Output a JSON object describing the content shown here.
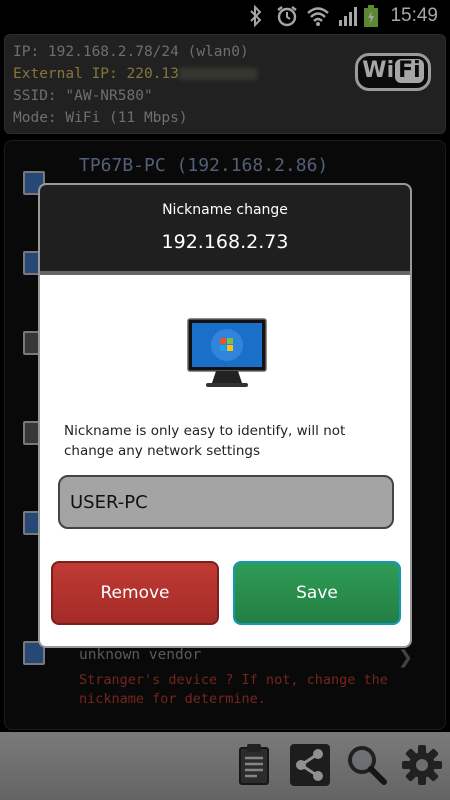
{
  "status_bar": {
    "time": "15:49",
    "icons": [
      "bluetooth-icon",
      "alarm-icon",
      "wifi-signal-icon",
      "cell-signal-icon",
      "battery-charging-icon"
    ]
  },
  "info": {
    "ip": "IP: 192.168.2.78/24 (wlan0)",
    "external_ip_prefix": "External IP: 220.13",
    "ssid": "SSID: \"AW-NR580\"",
    "mode": "Mode: WiFi (11 Mbps)",
    "logo_wi": "Wi",
    "logo_fi": "Fi"
  },
  "device_list": {
    "first_title": "TP67B-PC (192.168.2.86)",
    "last_sub": "unknown vendor",
    "last_warning": "Stranger's device ? If not, change the nickname for determine."
  },
  "dialog": {
    "title": "Nickname change",
    "ip": "192.168.2.73",
    "message": "Nickname is only easy to identify, will not change any network settings",
    "input_value": "USER-PC",
    "remove_label": "Remove",
    "save_label": "Save"
  },
  "toolbar": {
    "icons": [
      "clipboard-icon",
      "share-icon",
      "search-icon",
      "gear-icon"
    ]
  },
  "colors": {
    "remove": "#b0312d",
    "save": "#2a8c4d",
    "external_ip": "#cdb45a",
    "warning": "#b23a2a"
  }
}
